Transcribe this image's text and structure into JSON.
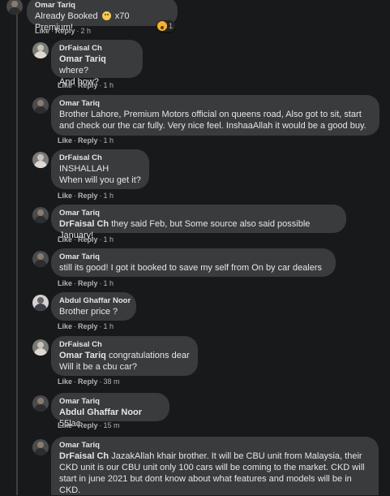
{
  "actions": {
    "like": "Like",
    "reply": "Reply",
    "separator": "·"
  },
  "comments": [
    {
      "author": "Omar Tariq",
      "text_before": "Already Booked",
      "emoji": "smiling-face",
      "text_after": "x70 Premium!",
      "time": "2 h",
      "reaction": {
        "type": "wow",
        "count": "1"
      }
    },
    {
      "author": "DrFaisal Ch",
      "mention": "Omar Tariq",
      "text": "where?",
      "text2": "And how?",
      "time": "1 h"
    },
    {
      "author": "Omar Tariq",
      "text": "Brother Lahore, Premium Motors official on queens road, Also got to sit, start and check our the car fully. Very nice feel. InshaaAllah it would be a good buy.",
      "time": "1 h"
    },
    {
      "author": "DrFaisal Ch",
      "text": "INSHALLAH",
      "text2": "When will you get it?",
      "time": "1 h"
    },
    {
      "author": "Omar Tariq",
      "mention": "DrFaisal Ch",
      "text": "they said Feb, but Some source also said possible January!",
      "time": "1 h"
    },
    {
      "author": "Omar Tariq",
      "text": "still its good! I got it booked to save my self from On by car dealers",
      "time": "1 h"
    },
    {
      "author": "Abdul Ghaffar Noor",
      "text": "Brother price ?",
      "time": "1 h"
    },
    {
      "author": "DrFaisal Ch",
      "mention": "Omar Tariq",
      "text": "congratulations dear",
      "text2": "Will it be a cbu car?",
      "time": "38 m"
    },
    {
      "author": "Omar Tariq",
      "mention": "Abdul Ghaffar Noor",
      "text": "55lac",
      "time": "15 m"
    },
    {
      "author": "Omar Tariq",
      "mention": "DrFaisal Ch",
      "text": "JazakAllah khair brother. It will be CBU unit from Malaysia, their CKD unit is our CBU unit only 100 cars will be coming to the market. CKD will start in june 2021 but dont know about what features and models will be in CKD."
    }
  ]
}
